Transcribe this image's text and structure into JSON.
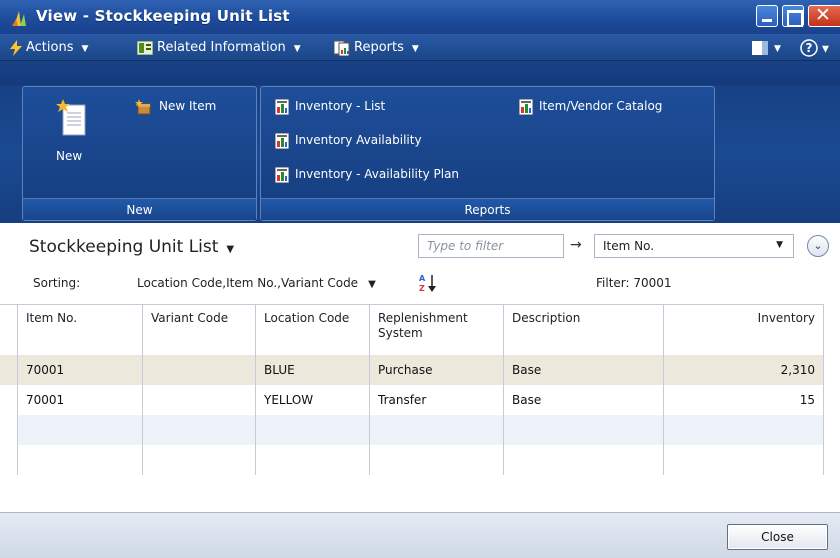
{
  "window": {
    "title": "View - Stockkeeping Unit List"
  },
  "commandbar": {
    "actions": "Actions",
    "related": "Related Information",
    "reports": "Reports"
  },
  "ribbon": {
    "new_group": {
      "caption": "New",
      "new_label": "New",
      "new_item": "New Item"
    },
    "reports_group": {
      "caption": "Reports",
      "items": [
        "Inventory - List",
        "Inventory Availability",
        "Inventory - Availability Plan",
        "Item/Vendor Catalog"
      ]
    }
  },
  "list": {
    "title": "Stockkeeping Unit List",
    "filter_placeholder": "Type to filter",
    "filter_field": "Item No.",
    "sorting_label": "Sorting:",
    "sorting_value": "Location Code,Item No.,Variant Code",
    "filter_text": "Filter: 70001"
  },
  "table": {
    "headers": [
      "Item No.",
      "Variant Code",
      "Location Code",
      "Replenishment System",
      "Description",
      "Inventory"
    ],
    "rows": [
      [
        "70001",
        "",
        "BLUE",
        "Purchase",
        "Base",
        "2,310"
      ],
      [
        "70001",
        "",
        "YELLOW",
        "Transfer",
        "Base",
        "15"
      ]
    ]
  },
  "footer": {
    "close_label": "Close"
  },
  "colors": {
    "selected_row": "#ece9dc",
    "alt_row": "#eef2f9",
    "titlebar": "#1d4a9a"
  }
}
